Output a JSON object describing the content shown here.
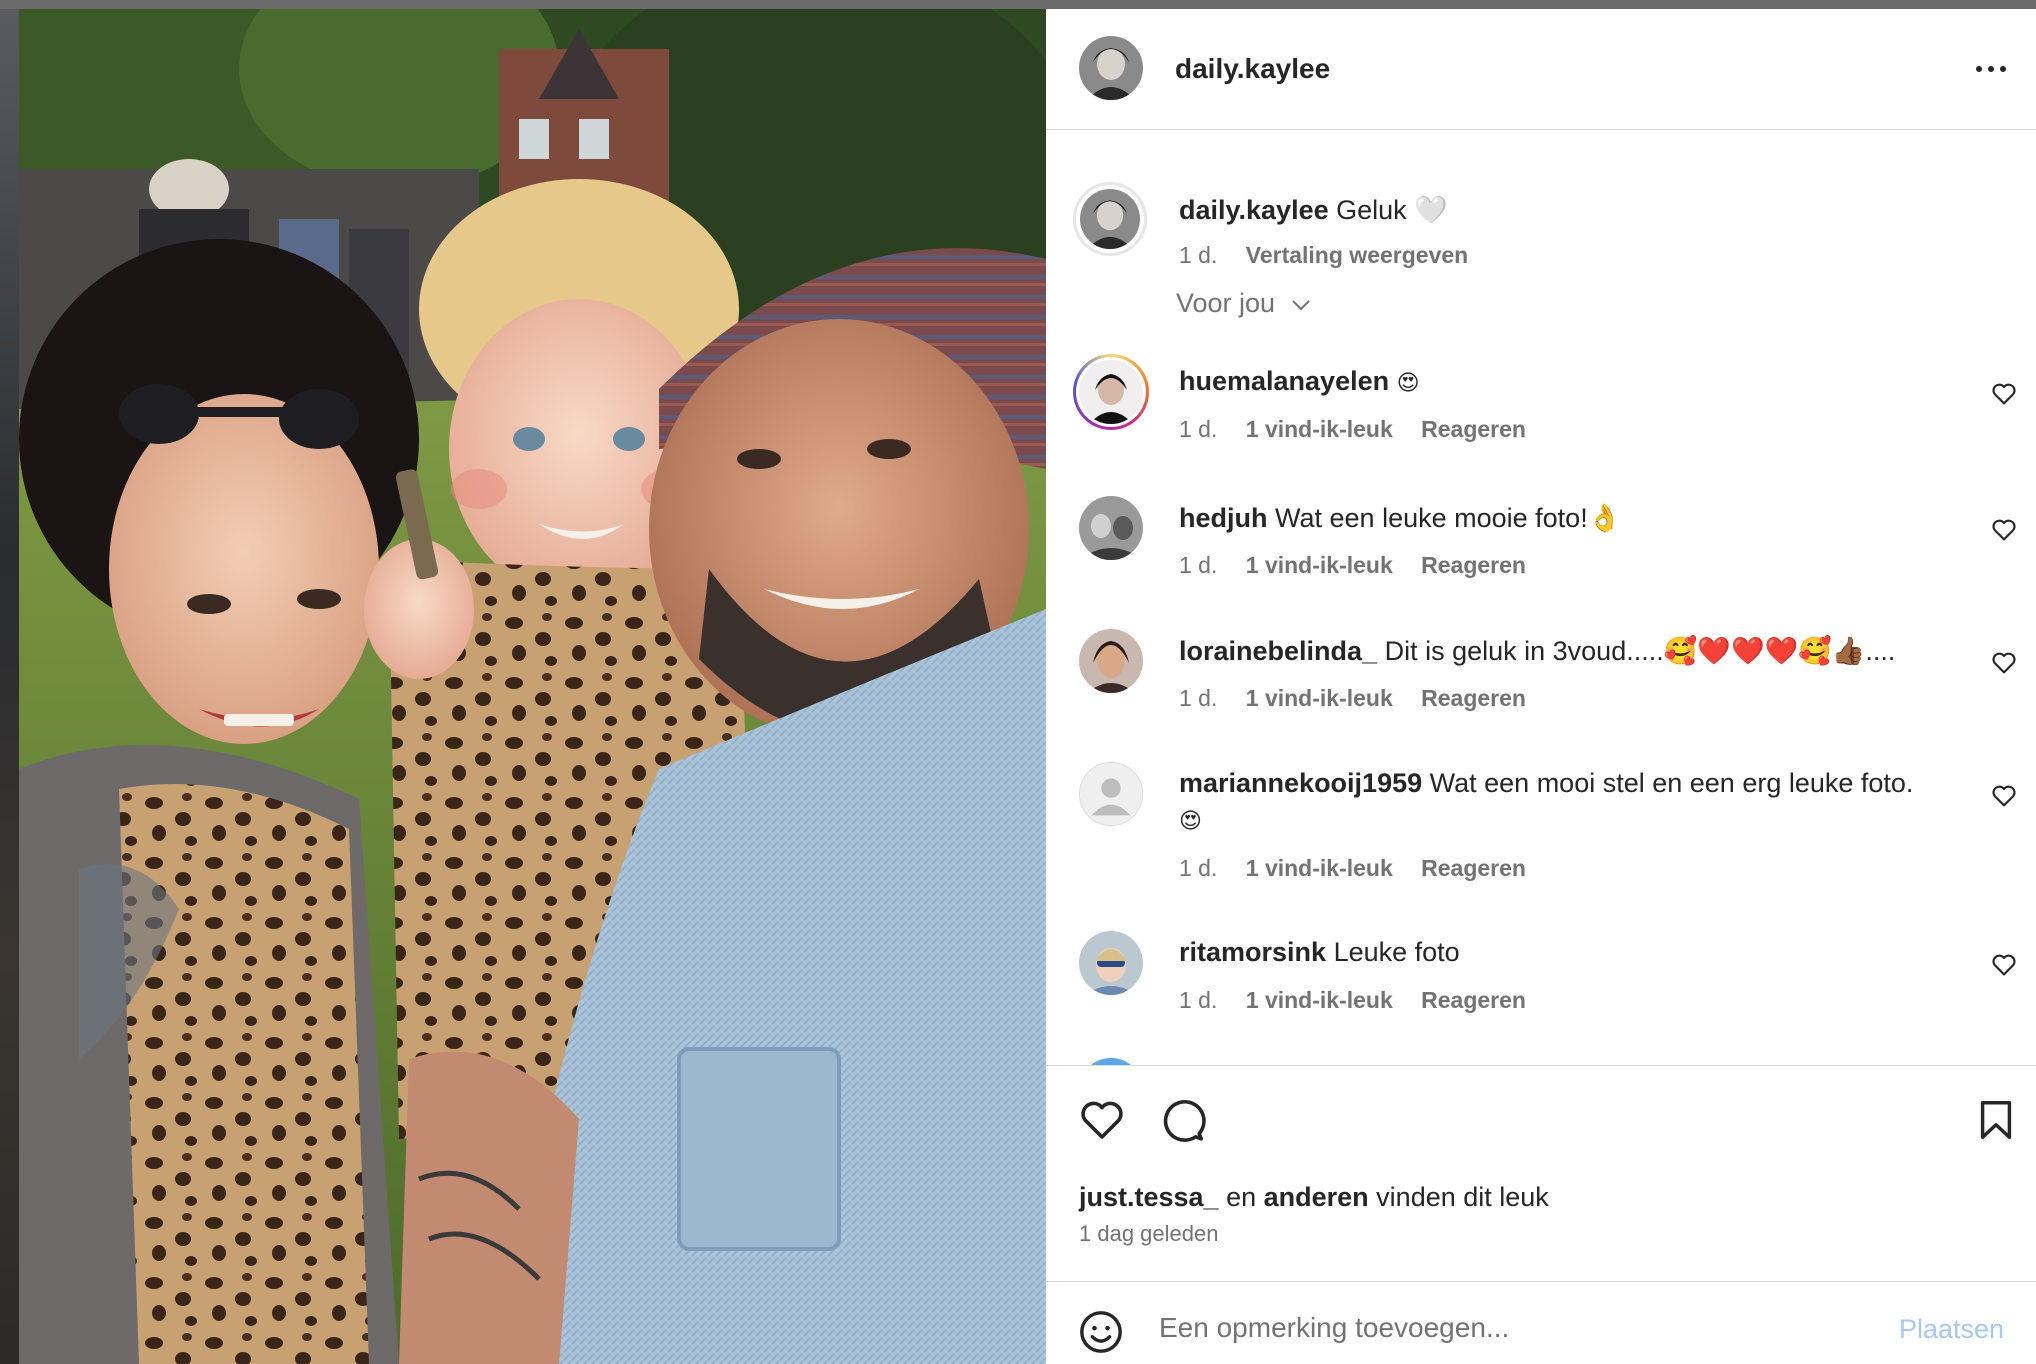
{
  "post": {
    "username": "daily.kaylee",
    "more_icon": "more-horizontal-icon"
  },
  "caption": {
    "username": "daily.kaylee",
    "text": "Geluk 🤍",
    "time": "1 d.",
    "translate": "Vertaling weergeven"
  },
  "for_you": {
    "label": "Voor jou",
    "icon": "chevron-down-icon"
  },
  "comments": [
    {
      "username": "huemalanayelen",
      "text": "😍",
      "time": "1 d.",
      "likes": "1 vind-ik-leuk",
      "reply": "Reageren"
    },
    {
      "username": "hedjuh",
      "text": "Wat een leuke mooie foto!👌",
      "time": "1 d.",
      "likes": "1 vind-ik-leuk",
      "reply": "Reageren"
    },
    {
      "username": "lorainebelinda_",
      "text": "Dit is geluk in 3voud.....🥰❤️❤️❤️🥰👍🏾....",
      "time": "1 d.",
      "likes": "1 vind-ik-leuk",
      "reply": "Reageren"
    },
    {
      "username": "mariannekooij1959",
      "text": "Wat een mooi stel en een erg leuke foto.",
      "text2": "😍",
      "time": "1 d.",
      "likes": "1 vind-ik-leuk",
      "reply": "Reageren"
    },
    {
      "username": "ritamorsink",
      "text": "Leuke foto",
      "time": "1 d.",
      "likes": "1 vind-ik-leuk",
      "reply": "Reageren"
    }
  ],
  "likes": {
    "user": "just.tessa_",
    "connector": " en ",
    "others": "anderen",
    "suffix": " vinden dit leuk",
    "timestamp": "1 dag geleden"
  },
  "add_comment": {
    "placeholder": "Een opmerking toevoegen...",
    "post_label": "Plaatsen",
    "emoji_icon": "smiley-icon"
  },
  "colors": {
    "accent_disabled": "#a6c8f7",
    "text_primary": "#262626",
    "text_secondary": "#737373",
    "divider": "#dbdbdb"
  }
}
